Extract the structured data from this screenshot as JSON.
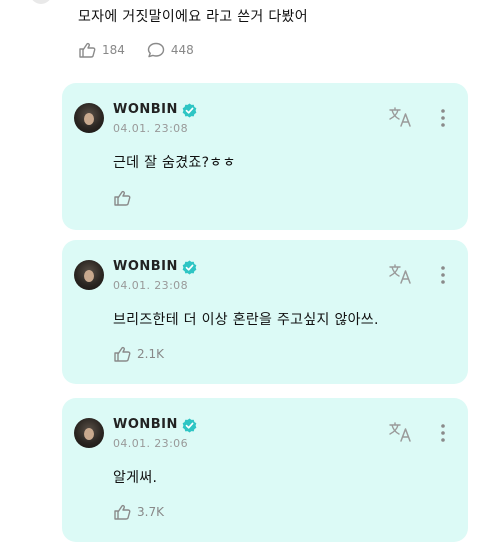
{
  "fan_post": {
    "text": "모자에 거짓말이에요 라고 쓴거 다봤어",
    "like_count": "184",
    "comment_count": "448"
  },
  "replies": [
    {
      "name": "WONBIN",
      "time": "04.01. 23:08",
      "text": "근데 잘 숨겼죠?ㅎㅎ",
      "like_count": ""
    },
    {
      "name": "WONBIN",
      "time": "04.01. 23:08",
      "text": "브리즈한테 더 이상 혼란을 주고싶지 않아쓰.",
      "like_count": "2.1K"
    },
    {
      "name": "WONBIN",
      "time": "04.01. 23:06",
      "text": "알게써.",
      "like_count": "3.7K"
    }
  ],
  "icons": {
    "like": "like-hand-icon",
    "comment": "comment-bubble-icon",
    "verified": "verified-badge-icon",
    "translate": "translate-icon",
    "more": "more-vertical-icon"
  },
  "colors": {
    "card_background": "#dcfaf6",
    "verified_badge": "#2ec5c4",
    "muted_text": "#888888"
  }
}
